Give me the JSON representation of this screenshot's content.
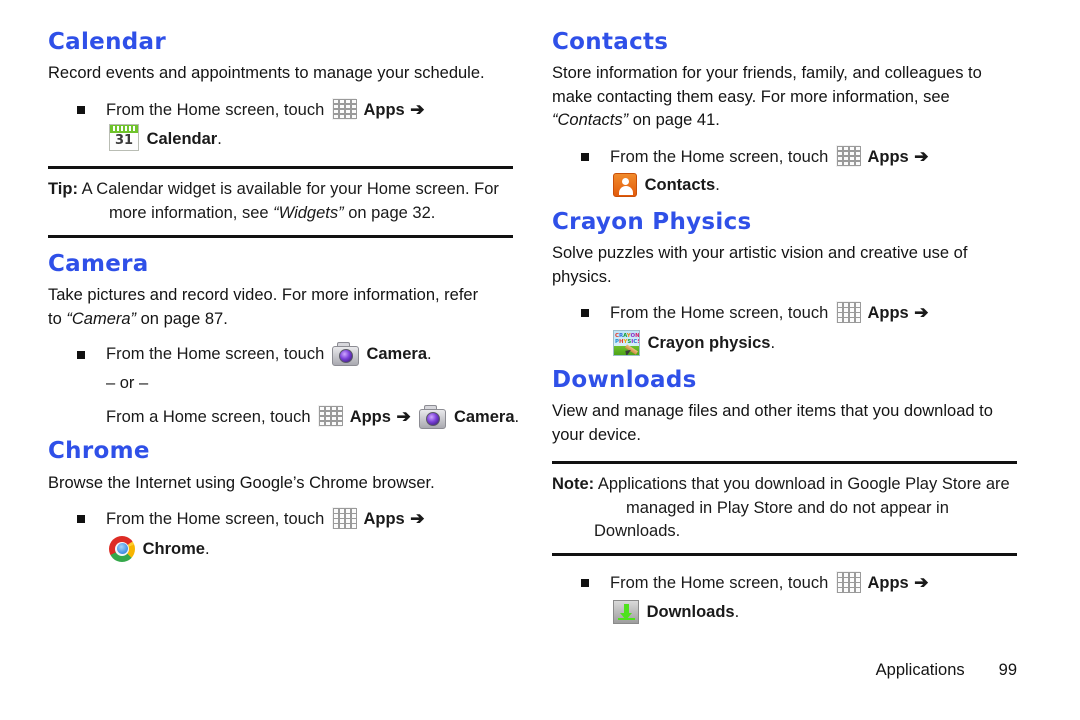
{
  "document": {
    "type": "user-manual-page",
    "footer": {
      "section": "Applications",
      "page_number": "99"
    },
    "accent_heading_color": "#2f50e8"
  },
  "left_column": {
    "calendar": {
      "heading": "Calendar",
      "body": "Record events and appointments to manage your schedule.",
      "step_prefix": "From the Home screen, touch",
      "apps_label": "Apps",
      "arrow": "➔",
      "app_label": "Calendar",
      "app_label_period": ".",
      "calendar_icon_day": "31"
    },
    "tip": {
      "label": "Tip:",
      "line1": " A Calendar widget is available for your Home screen. For",
      "line2_pre": "more information, see ",
      "line2_ital": "“Widgets”",
      "line2_post": " on page 32."
    },
    "camera": {
      "heading": "Camera",
      "body_pre": "Take pictures and record video. For more information, refer",
      "body_line2_pre": "to ",
      "body_line2_ital": "“Camera”",
      "body_line2_post": " on page 87.",
      "step_prefix": "From the Home screen, touch",
      "app_label": "Camera",
      "or_text": "– or –",
      "alt_step_prefix": "From a Home screen, touch",
      "apps_label": "Apps",
      "arrow": "➔"
    },
    "chrome": {
      "heading": "Chrome",
      "body": "Browse the Internet using Google’s Chrome browser.",
      "step_prefix": "From the Home screen, touch",
      "apps_label": "Apps",
      "arrow": "➔",
      "app_label": "Chrome"
    }
  },
  "right_column": {
    "contacts": {
      "heading": "Contacts",
      "body_line1": "Store information for your friends, family, and colleagues to",
      "body_line2": "make contacting them easy. For more information, see",
      "body_line3_ital": "“Contacts”",
      "body_line3_post": " on page 41.",
      "step_prefix": "From the Home screen, touch",
      "apps_label": "Apps",
      "arrow": "➔",
      "app_label": "Contacts"
    },
    "crayon_physics": {
      "heading": "Crayon Physics",
      "body_line1": "Solve puzzles with your artistic vision and creative use of",
      "body_line2": "physics.",
      "step_prefix": "From the Home screen, touch",
      "apps_label": "Apps",
      "arrow": "➔",
      "app_label": "Crayon physics",
      "icon_text_line1": [
        "C",
        "R",
        "A",
        "Y",
        "O",
        "N"
      ],
      "icon_text_line2": [
        "P",
        "H",
        "Y",
        "S",
        "I",
        "C",
        "S"
      ]
    },
    "downloads": {
      "heading": "Downloads",
      "body_line1": "View and manage files and other items that you download to",
      "body_line2": "your device.",
      "note": {
        "label": "Note:",
        "line1": " Applications that you download in Google Play Store are",
        "line2": "managed in Play Store and do not appear in Downloads."
      },
      "step_prefix": "From the Home screen, touch",
      "apps_label": "Apps",
      "arrow": "➔",
      "app_label": "Downloads"
    }
  },
  "icons": {
    "apps": "apps-grid-icon",
    "calendar": "calendar-app-icon",
    "camera": "camera-app-icon",
    "chrome": "chrome-app-icon",
    "contacts": "contacts-app-icon",
    "crayon": "crayon-physics-app-icon",
    "downloads": "downloads-app-icon"
  }
}
